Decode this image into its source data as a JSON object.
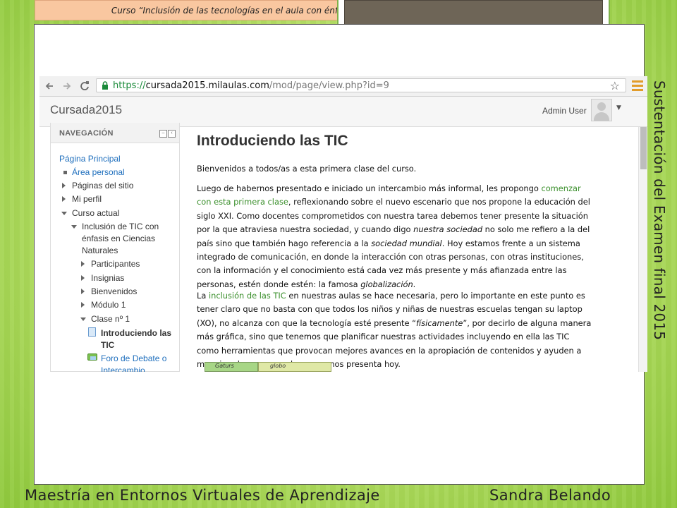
{
  "slide": {
    "course_banner": "Curso “Inclusión de las tecnologías en el  aula con énfasis en Ciencias Naturales”",
    "vertical_title": "Sustentación del Examen final   2015",
    "footer_left": "Maestría en Entornos Virtuales de Aprendizaje",
    "footer_right": "Sandra Belando"
  },
  "browser": {
    "url_scheme": "https://",
    "url_host": "cursada2015.milaulas.com",
    "url_path": "/mod/page/view.php?id=9",
    "back_icon": "back-arrow-icon",
    "forward_icon": "forward-arrow-icon",
    "reload_icon": "reload-icon",
    "bookmark_icon": "star-icon",
    "menu_icon": "hamburger-menu-icon",
    "menu_color": "#e29c2a"
  },
  "header": {
    "site_name": "Cursada2015",
    "user_name": "Admin User"
  },
  "navigation": {
    "title": "NAVEGACIÓN",
    "items": [
      {
        "label": "Página Principal"
      },
      {
        "label": "Área personal"
      },
      {
        "label": "Páginas del sitio"
      },
      {
        "label": "Mi perfil"
      },
      {
        "label": "Curso actual"
      },
      {
        "label": "Inclusión de TIC con"
      },
      {
        "label": "énfasis en Ciencias"
      },
      {
        "label": "Naturales"
      },
      {
        "label": "Participantes"
      },
      {
        "label": "Insignias"
      },
      {
        "label": "Bienvenidos"
      },
      {
        "label": "Módulo 1"
      },
      {
        "label": "Clase nº 1"
      },
      {
        "label": "Introduciendo las"
      },
      {
        "label": "TIC"
      },
      {
        "label": "Foro de Debate o"
      },
      {
        "label": "Intercambio"
      }
    ]
  },
  "content": {
    "title": "Introduciendo las TIC",
    "p1": "Bienvenidos a todos/as a esta primera clase del curso.",
    "p2_l1a": "Luego de habernos presentado e iniciado un intercambio más informal, les propongo ",
    "p2_l1b": "comenzar",
    "p2_l2a": "con esta primera clase",
    "p2_l2b": ", reflexionando sobre el nuevo escenario que nos propone la educación del",
    "p2_l3": "siglo XXI. Como docentes comprometidos con nuestra tarea debemos tener presente la situación",
    "p2_l4a": "por la que atraviesa nuestra sociedad, y cuando digo ",
    "p2_l4b": "nuestra sociedad",
    "p2_l4c": " no solo me refiero a la del",
    "p2_l5a": "país sino que también hago referencia a la ",
    "p2_l5b": "sociedad mundial",
    "p2_l5c": ". Hoy estamos frente a  un sistema",
    "p2_l6": "integrado de comunicación, en donde la interacción con otras personas, con otras instituciones,",
    "p2_l7": "con la información y el conocimiento está cada vez más presente y  más afianzada entre las",
    "p2_l8a": "personas, estén donde estén: la famosa ",
    "p2_l8b": "globalización",
    "p2_l8c": ".",
    "p3_l1a": "La ",
    "p3_l1b": "inclusión de las TIC",
    "p3_l1c": " en nuestras aulas se hace necesaria, pero lo importante en este punto es",
    "p3_l2": "tener claro que no basta con que todos los niños y niñas de nuestras escuelas tengan su laptop",
    "p3_l3a": "(XO), no alcanza con que la tecnología esté presente “",
    "p3_l3b": "físicamente",
    "p3_l3c": "”, por decirlo de alguna manera",
    "p3_l4": "más gráfica, sino que tenemos que planificar nuestras actividades incluyendo en ella las TIC",
    "p3_l5": "como herramientas que provocan mejores avances en la apropiación de contenidos y ayuden   a",
    "p3_l6": "manejar el nuevo mundo que se nos presenta hoy.",
    "illus_a": "Gaturs",
    "illus_b": "globo"
  }
}
